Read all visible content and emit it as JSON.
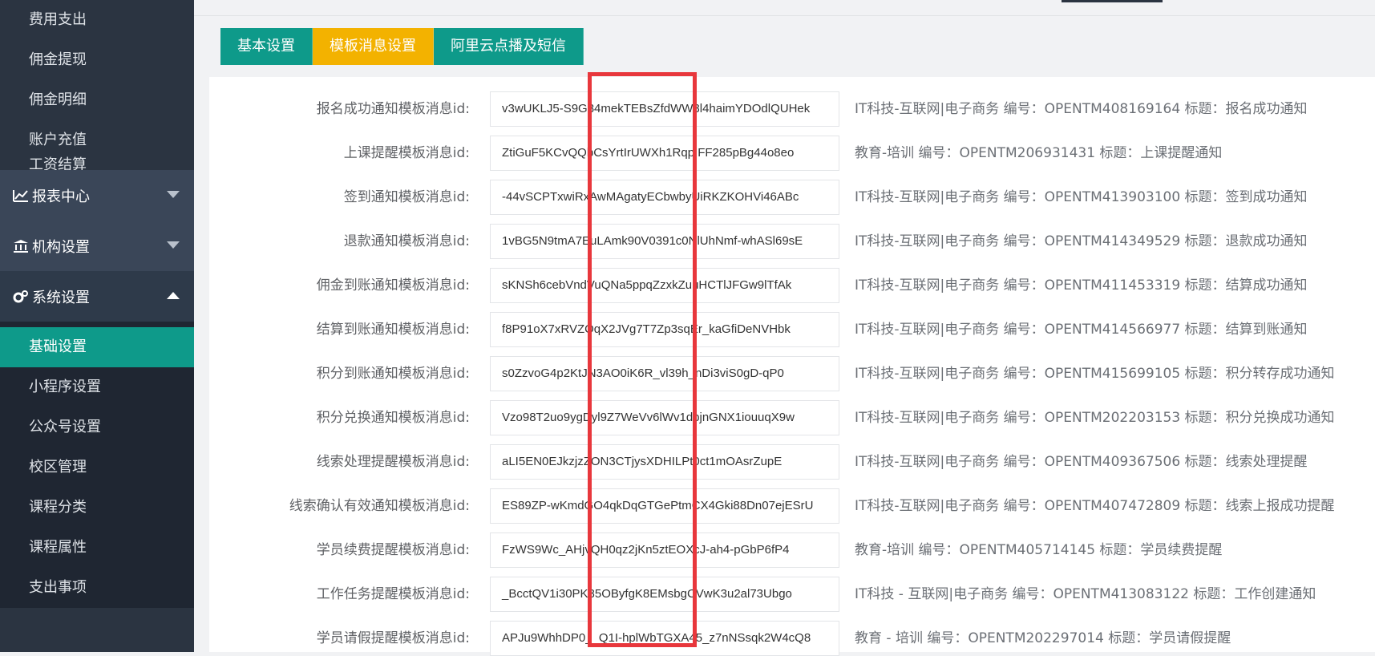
{
  "sidebar": {
    "top_items": [
      "费用支出",
      "佣金提现",
      "佣金明细",
      "账户充值",
      "工资结算"
    ],
    "sections": [
      {
        "label": "报表中心",
        "icon": "chart-line-icon",
        "expanded": false
      },
      {
        "label": "机构设置",
        "icon": "bank-icon",
        "expanded": false
      },
      {
        "label": "系统设置",
        "icon": "gears-icon",
        "expanded": true
      }
    ],
    "system_items": [
      "基础设置",
      "小程序设置",
      "公众号设置",
      "校区管理",
      "课程分类",
      "课程属性",
      "支出事项"
    ],
    "active_item": "基础设置"
  },
  "tabs": [
    "基本设置",
    "模板消息设置",
    "阿里云点播及短信"
  ],
  "active_tab": "模板消息设置",
  "templates": [
    {
      "label": "报名成功通知模板消息id:",
      "value": "v3wUKLJ5-S9G84mekTEBsZfdWW8l4haimYDOdlQUHek",
      "hint": "IT科技-互联网|电子商务 编号：OPENTM408169164 标题：报名成功通知"
    },
    {
      "label": "上课提醒模板消息id:",
      "value": "ZtiGuF5KCvQQbCsYrtIrUWXh1RqpIFF285pBg44o8eo",
      "hint": "教育-培训 编号：OPENTM206931431 标题：上课提醒通知"
    },
    {
      "label": "签到通知模板消息id:",
      "value": "-44vSCPTxwiRxAwMAgatyECbwbyUiRKZKOHVi46ABc",
      "hint": "IT科技-互联网|电子商务 编号：OPENTM413903100 标题：签到成功通知"
    },
    {
      "label": "退款通知模板消息id:",
      "value": "1vBG5N9tmA7EuLAmk90V0391c0NlUhNmf-whASl69sE",
      "hint": "IT科技-互联网|电子商务 编号：OPENTM414349529 标题：退款成功通知"
    },
    {
      "label": "佣金到账通知模板消息id:",
      "value": "sKNSh6cebVndVuQNa5ppqZzxkZuuHCTlJFGw9lTfAk",
      "hint": "IT科技-互联网|电子商务 编号：OPENTM411453319 标题：结算成功通知"
    },
    {
      "label": "结算到账通知模板消息id:",
      "value": "f8P91oX7xRVZOqX2JVg7T7Zp3sqEr_kaGfiDeNVHbk",
      "hint": "IT科技-互联网|电子商务 编号：OPENTM414566977 标题：结算到账通知"
    },
    {
      "label": "积分到账通知模板消息id:",
      "value": "s0ZzvoG4p2KtJN3AO0iK6R_vl39h_nDi3viS0gD-qP0",
      "hint": "IT科技-互联网|电子商务 编号：OPENTM415699105 标题：积分转存成功通知"
    },
    {
      "label": "积分兑换通知模板消息id:",
      "value": "Vzo98T2uo9ygDyl9Z7WeVv6lWv1dpjnGNX1iouuqX9w",
      "hint": "IT科技-互联网|电子商务 编号：OPENTM202203153 标题：积分兑换成功通知"
    },
    {
      "label": "线索处理提醒模板消息id:",
      "value": "aLI5EN0EJkzjzZON3CTjysXDHILPt0ct1mOAsrZupE",
      "hint": "IT科技-互联网|电子商务 编号：OPENTM409367506 标题：线索处理提醒"
    },
    {
      "label": "线索确认有效通知模板消息id:",
      "value": "ES89ZP-wKmdGO4qkDqGTGePtmCX4Gki88Dn07ejESrU",
      "hint": "IT科技-互联网|电子商务 编号：OPENTM407472809 标题：线索上报成功提醒"
    },
    {
      "label": "学员续费提醒模板消息id:",
      "value": "FzWS9Wc_AHjvQH0qz2jKn5ztEOXcJ-ah4-pGbP6fP4",
      "hint": "教育-培训 编号：OPENTM405714145 标题：学员续费提醒"
    },
    {
      "label": "工作任务提醒模板消息id:",
      "value": "_BcctQV1i30PK85OByfgK8EMsbgCVwK3u2al73Ubgo",
      "hint": "IT科技 - 互联网|电子商务 编号：OPENTM413083122 标题：工作创建通知"
    },
    {
      "label": "学员请假提醒模板消息id:",
      "value": "APJu9WhhDP0__Q1I-hplWbTGXA45_z7nNSsqk2W4cQ8",
      "hint": "教育 - 培训 编号：OPENTM202297014 标题：学员请假提醒"
    }
  ],
  "colors": {
    "primary": "#0e9a8a",
    "active_tab": "#f3b200",
    "highlight": "#e8373c",
    "sidebar": "#2b3441"
  }
}
